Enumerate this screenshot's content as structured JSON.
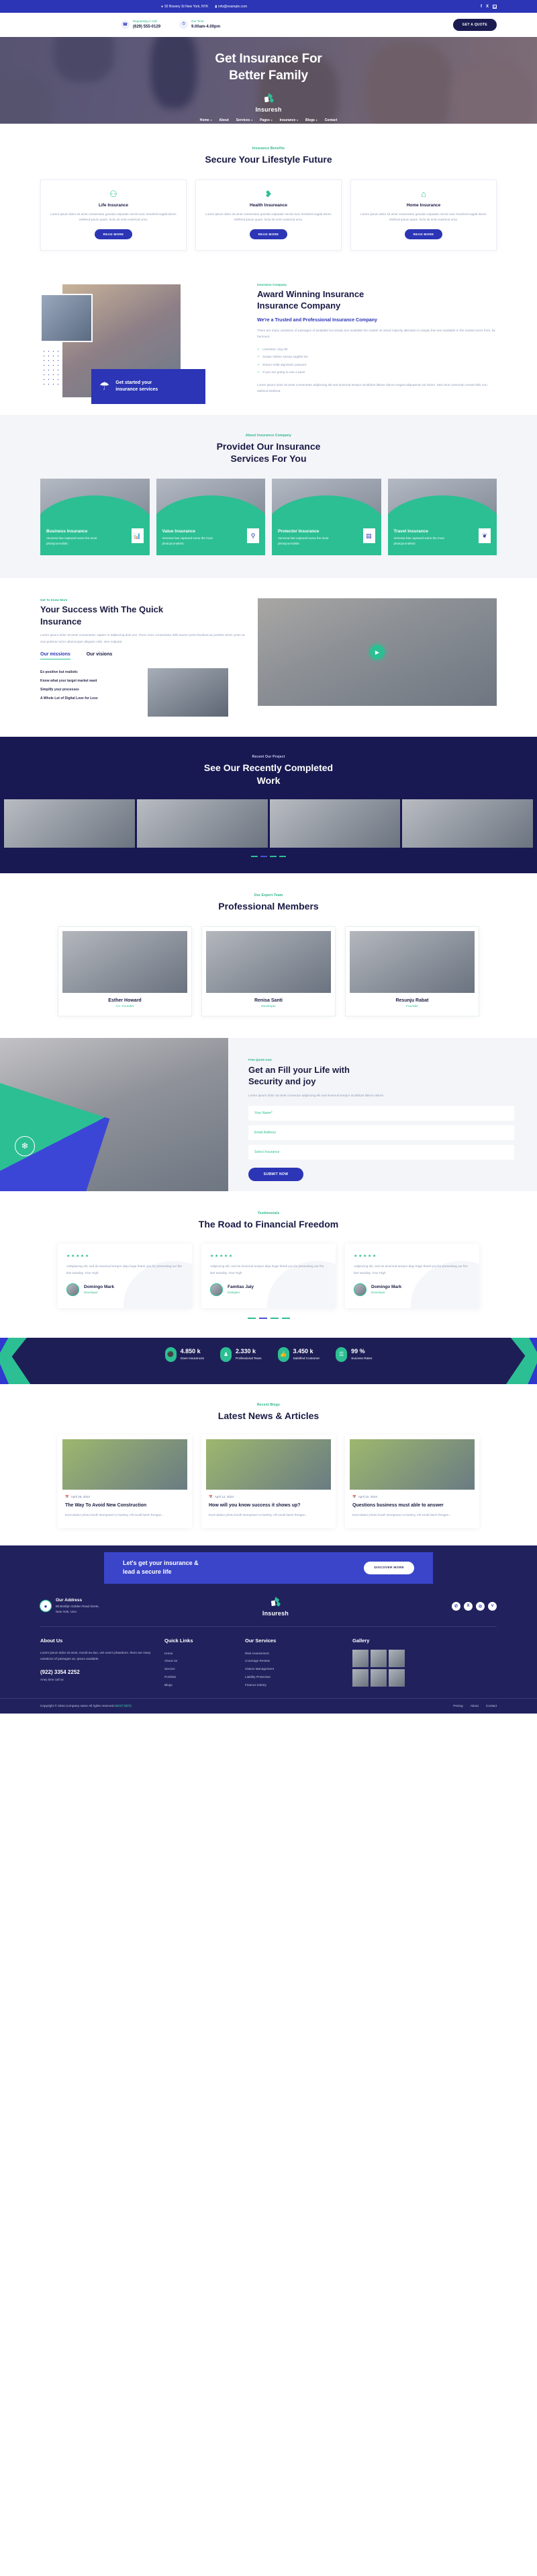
{
  "topbar": {
    "address": "92 Bowery St New York, NYK",
    "email": "info@example.com",
    "social": [
      "f",
      "X",
      "in"
    ]
  },
  "infobar": {
    "call_label": "Requesting A Call:",
    "call_value": "(629) 555-0129",
    "time_label": "Our Time:",
    "time_value": "9.00am-4.00pm",
    "quote_button": "GET A QUOTE"
  },
  "hero": {
    "title_line1": "Get Insurance For",
    "title_line2": "Better Family",
    "brand": "Insuresh",
    "nav": [
      {
        "label": "Home",
        "caret": true
      },
      {
        "label": "About",
        "caret": false
      },
      {
        "label": "Services",
        "caret": true
      },
      {
        "label": "Pages",
        "caret": true
      },
      {
        "label": "Insurance",
        "caret": true
      },
      {
        "label": "Blogs",
        "caret": true
      },
      {
        "label": "Contact",
        "caret": false
      }
    ],
    "search_icon": "search-icon"
  },
  "benefits": {
    "tag": "Insurance Benefits",
    "title": "Secure Your Lifestyle Future",
    "cards": [
      {
        "icon": "family-group-icon",
        "glyph": "⚇",
        "title": "Life Insurance",
        "text": "Lorem ipsum dolor sit amet consectetur gravida vulputate necsit nunc hendrerit sagitti donec eleifend ipsum quam. lectu sit enim euismod urna.",
        "button": "READ MORE"
      },
      {
        "icon": "broken-heart-icon",
        "glyph": "❥",
        "title": "Health Insureance",
        "text": "Lorem ipsum dolor sit amet consectetur gravida vulputate necsit nunc hendrerit sagitti donec eleifend ipsum quam. lectu sit enim euismod urna.",
        "button": "READ MORE"
      },
      {
        "icon": "home-icon",
        "glyph": "⌂",
        "title": "Home Insurance",
        "text": "Lorem ipsum dolor sit amet consectetur gravida vulputate necsit nunc hendrerit sagitti donec eleifend ipsum quam. lectu sit enim euismod urna.",
        "button": "READ MORE"
      }
    ]
  },
  "award": {
    "tag": "Insurance Company",
    "title_line1": "Award Winning Insurance",
    "title_line2": "Insurance Company",
    "subtitle": "We're a Trusted and Professional Insurance Company",
    "paragraph": "There are many variations of passages of available but simply text available the market sit amed majority alteration in simply free text available in the market some form, by humouor.",
    "list": [
      "Lsectetur cing elit",
      "Suspe ndisse suscip sagittis leo",
      "Entum estib dignissim posuere",
      "If you are going to use a pass"
    ],
    "footer_text": "Lorem ipsum dolor sit amet consectetur adipiscing elit sed eiusmod tempor incididunt labore dolore magna aliquaenim ad minim. Sed risus commodo ornare felis non, eleifend eleifend.",
    "badge_icon": "umbrella-protection-icon",
    "badge_line1": "Get started your",
    "badge_line2": "insurance services"
  },
  "services": {
    "tag": "About Insurance Company",
    "title_line1": "Providet Our Insurance",
    "title_line2": "Services For You",
    "cards": [
      {
        "title": "Business Insurance",
        "text": "Venessa has captured some the most photojournalistic",
        "icon": "bar-chart-icon",
        "glyph": "█"
      },
      {
        "title": "Value Insurance",
        "text": "Venessa has captured some the most photojournalistic",
        "icon": "bottle-icon",
        "glyph": "⚲"
      },
      {
        "title": "Protector Insurance",
        "text": "Venessa has captured some the most photojournalistic",
        "icon": "document-icon",
        "glyph": "▤"
      },
      {
        "title": "Travel Insurance",
        "text": "Venessa has captured some the most photojournalistic",
        "icon": "leaf-hand-icon",
        "glyph": "❦"
      }
    ]
  },
  "success": {
    "tag": "Get To Know More",
    "title_line1": "Your Success With The Quick",
    "title_line2": "Insurance",
    "paragraph": "Lorem ipsum dolor sit amet consectetur, sapien in adipiscing duis orci. rhonc nunc consectetur nibh auctor porta tincidunt ac porttitor amet. proin ac vive pulvinar tortor ullamcorper aliquam nirbi. sem vulputat",
    "tabs": [
      {
        "label": "Our missions",
        "active": true
      },
      {
        "label": "Our visions",
        "active": false
      }
    ],
    "bullets": [
      "Ex positive but realistic",
      "Know what your target market want",
      "Simplify your processes",
      "A Whole Lot of Digital Love for Less"
    ],
    "play_icon": "play-icon"
  },
  "projects": {
    "tag": "Recent Our Project",
    "title_line1": "See Our Recently Completed",
    "title_line2": "Work",
    "slide_count": 4
  },
  "team": {
    "tag": "Our Expert Team",
    "title": "Professional Members",
    "members": [
      {
        "name": "Esther Howard",
        "role": "Co- Founder"
      },
      {
        "name": "Renisa Santi",
        "role": "Developer"
      },
      {
        "name": "Resunju Rabat",
        "role": "Founder"
      }
    ]
  },
  "quote": {
    "tag": "Free Quote now",
    "title_line1": "Get an Fill your Life with",
    "title_line2": "Security and joy",
    "paragraph": "Lorem ipsum dolor sit amet consectur adipiscing elit sed eiusmod tempor incididunt labore dolore.",
    "fields": [
      {
        "name": "name-field",
        "placeholder": "Your Name*"
      },
      {
        "name": "email-field",
        "placeholder": "Email Address"
      },
      {
        "name": "insurance-select-field",
        "placeholder": "Select Insurance"
      }
    ],
    "submit": "SUBMIT NOW",
    "seal_icon": "award-seal-icon"
  },
  "testimonials": {
    "tag": "Testimonials",
    "title": "The Road to Financial Freedom",
    "cards": [
      {
        "stars": "★★★★★",
        "text": "AdSpiacing elit, sed do eiusmod tempor alqu.huge thank you for presenting our fire last tuesday. Your High",
        "name": "Domingo Mark",
        "role": "Developer"
      },
      {
        "stars": "★★★★★",
        "text": "Adipiscing elit, sed do eiusmod tempor alqu.huge thank you for presenting our fire last tuesday. Your High",
        "name": "Famitas Jaly",
        "role": "Designer"
      },
      {
        "stars": "★★★★★",
        "text": "Adipiscing elit, sed do eiusmod tempor alqu.huge thank you for presenting our fire last tuesday. Your High",
        "name": "Domingo Mark",
        "role": "Developer"
      }
    ],
    "dot_count": 4
  },
  "stats": [
    {
      "value": "4.850 k",
      "label": "Gave Insurances",
      "icon": "money-bag-icon",
      "glyph": "⛃"
    },
    {
      "value": "2.330 k",
      "label": "Professional Team",
      "icon": "team-group-icon",
      "glyph": "♟"
    },
    {
      "value": "3.450 k",
      "label": "Satisfied Customer",
      "icon": "thumbs-up-icon",
      "glyph": "☝"
    },
    {
      "value": "99 %",
      "label": "Success Rates",
      "icon": "list-bars-icon",
      "glyph": "☰"
    }
  ],
  "blog": {
    "tag": "Recent Blogs",
    "title": "Latest News & Articles",
    "posts": [
      {
        "date": "April 25, 2024",
        "title": "The Way To Avoid New Construction",
        "excerpt": "Exercitation photo booth stumptown to banksy, elit small batch freegan..."
      },
      {
        "date": "April 12, 2024",
        "title": "How will you know success it shows up?",
        "excerpt": "Exercitation photo booth stumptown to banksy, elit small batch freegan..."
      },
      {
        "date": "April 22, 2024",
        "title": "Questions business must able to answer",
        "excerpt": "Exercitation photo booth stumptown to banksy, elit small batch freegan..."
      }
    ]
  },
  "cta": {
    "line1": "Let's get your insurance &",
    "line2": "lead a secure life",
    "button": "DISCOVER MORE"
  },
  "footer": {
    "address_title": "Our Address",
    "address_line1": "88 Broklyn Golden Road Street,",
    "address_line2": "New York, USA",
    "brand": "Insuresh",
    "social": [
      "✆",
      "X",
      "◎",
      "v"
    ],
    "about": {
      "heading": "About Us",
      "text": "Lorem ipsum dolor sit amet, mundi ea duo, vim exerci phaedrum. there are many variations of passages as, Ipsum available.",
      "phone": "(922) 3354 2252",
      "sub": "Aney time call us"
    },
    "quick": {
      "heading": "Quick Links",
      "items": [
        "Home",
        "About Us",
        "Service",
        "Portfolio",
        "Blogs"
      ]
    },
    "services": {
      "heading": "Our Services",
      "items": [
        "Risk Assessment",
        "Coverage Review",
        "Claims Management",
        "Liability Protection",
        "Finance indstry"
      ]
    },
    "gallery": {
      "heading": "Gallery",
      "count": 6
    },
    "copyright_pre": "Copyright © 2024.Company name All rights reserved.",
    "copyright_hl": "NEXT INFO",
    "bottom_links": [
      "Pricing",
      "About",
      "Contact"
    ]
  }
}
